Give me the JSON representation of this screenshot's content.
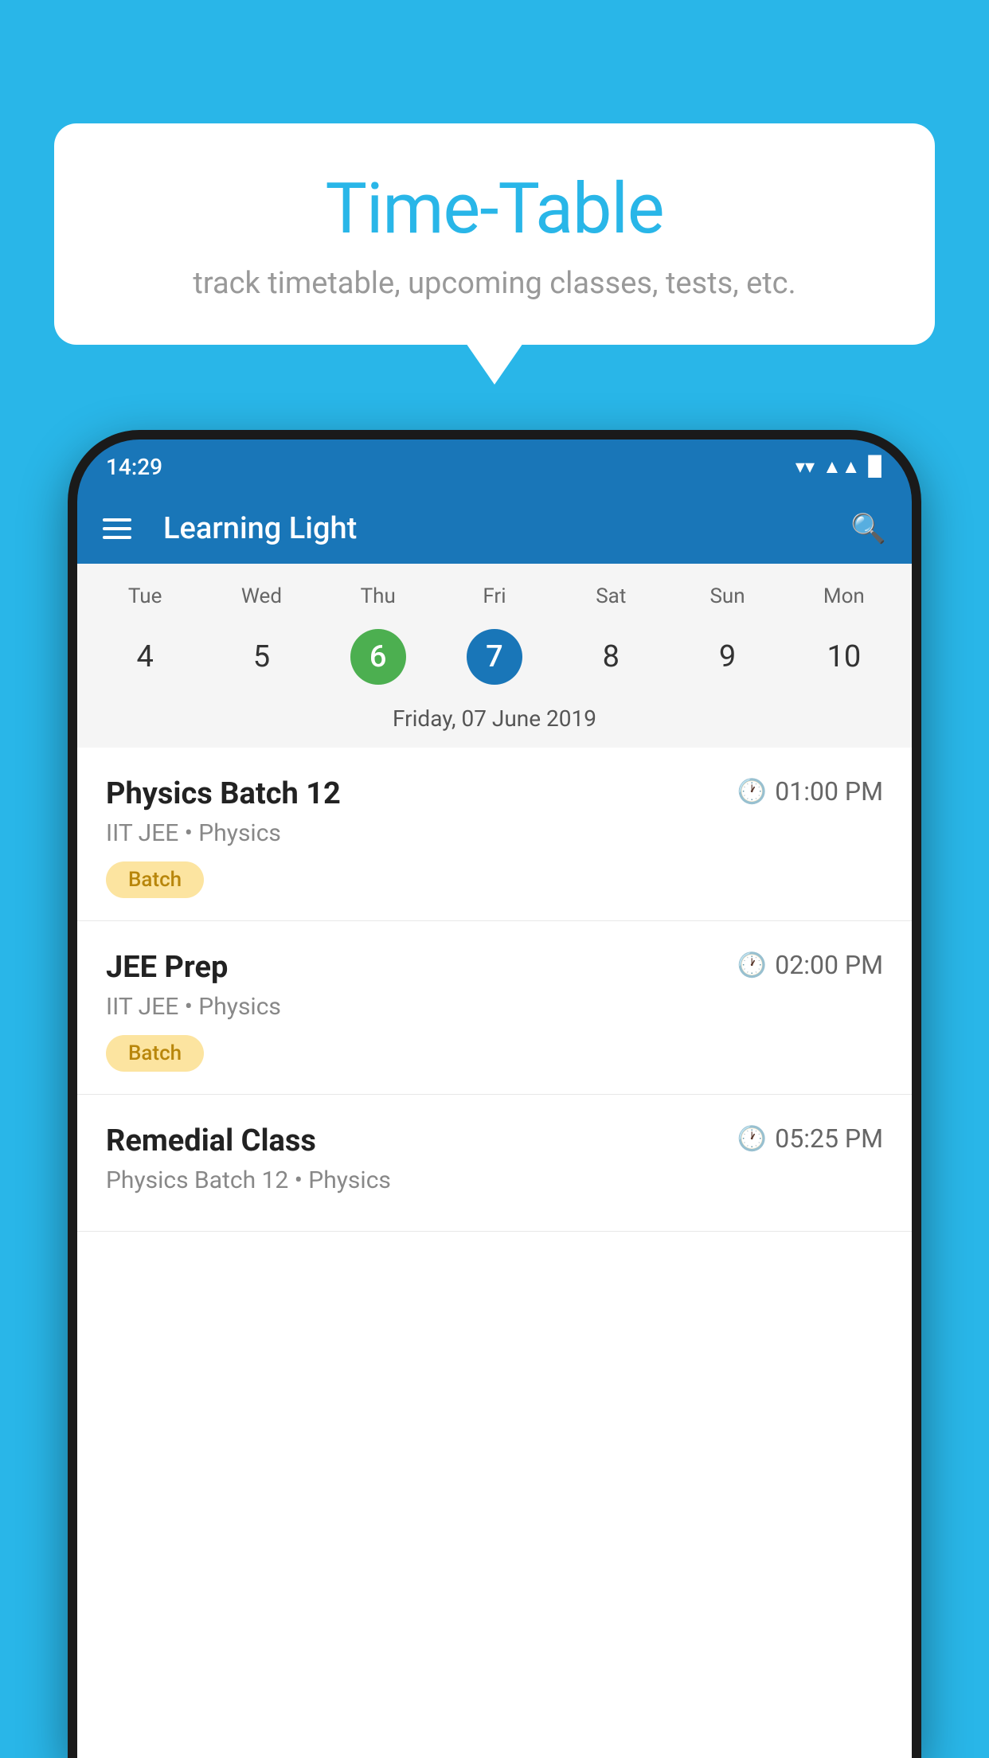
{
  "background_color": "#29b6e8",
  "tooltip": {
    "title": "Time-Table",
    "subtitle": "track timetable, upcoming classes, tests, etc."
  },
  "phone": {
    "status_bar": {
      "time": "14:29",
      "icons": [
        "▲",
        "▲",
        "▉"
      ]
    },
    "app_bar": {
      "title": "Learning Light"
    },
    "calendar": {
      "days": [
        "Tue",
        "Wed",
        "Thu",
        "Fri",
        "Sat",
        "Sun",
        "Mon"
      ],
      "dates": [
        "4",
        "5",
        "6",
        "7",
        "8",
        "9",
        "10"
      ],
      "today_index": 2,
      "selected_index": 3,
      "selected_label": "Friday, 07 June 2019"
    },
    "classes": [
      {
        "name": "Physics Batch 12",
        "time": "01:00 PM",
        "subject_line": "IIT JEE • Physics",
        "tag": "Batch"
      },
      {
        "name": "JEE Prep",
        "time": "02:00 PM",
        "subject_line": "IIT JEE • Physics",
        "tag": "Batch"
      },
      {
        "name": "Remedial Class",
        "time": "05:25 PM",
        "subject_line": "Physics Batch 12 • Physics",
        "tag": null
      }
    ]
  }
}
